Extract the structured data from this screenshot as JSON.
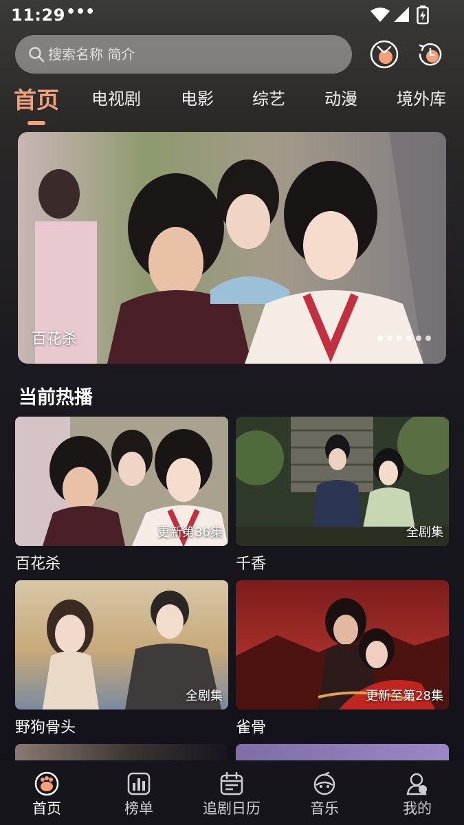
{
  "status": {
    "time": "11:29",
    "dots": "•••"
  },
  "search": {
    "placeholder": "搜索名称 简介"
  },
  "tabs": [
    {
      "label": "首页",
      "active": true
    },
    {
      "label": "电视剧"
    },
    {
      "label": "电影"
    },
    {
      "label": "综艺"
    },
    {
      "label": "动漫"
    },
    {
      "label": "境外库"
    }
  ],
  "banner": {
    "title": "百花杀",
    "page_count": 6,
    "current_page": 1
  },
  "section": {
    "title": "当前热播"
  },
  "cards": [
    {
      "name": "百花杀",
      "badge": "更新第36集"
    },
    {
      "name": "千香",
      "badge": "全剧集"
    },
    {
      "name": "野狗骨头",
      "badge": "全剧集"
    },
    {
      "name": "雀骨",
      "badge": "更新至第28集"
    }
  ],
  "bottom_nav": [
    {
      "label": "首页",
      "icon": "home-icon",
      "active": true
    },
    {
      "label": "榜单",
      "icon": "chart-icon"
    },
    {
      "label": "追剧日历",
      "icon": "calendar-icon"
    },
    {
      "label": "音乐",
      "icon": "music-icon"
    },
    {
      "label": "我的",
      "icon": "profile-icon"
    }
  ],
  "colors": {
    "accent": "#f4a07a",
    "background": "#121019"
  }
}
